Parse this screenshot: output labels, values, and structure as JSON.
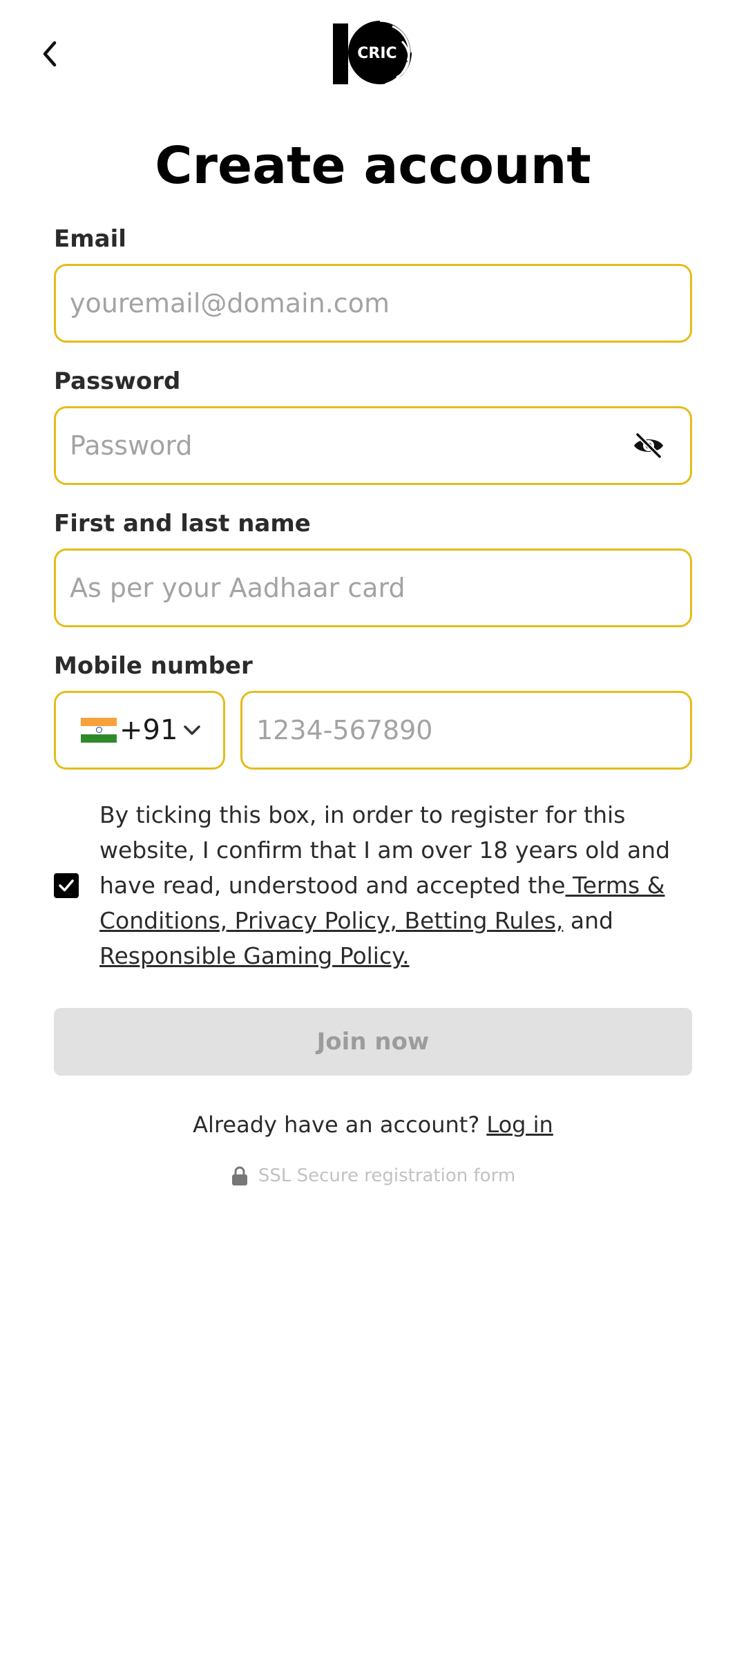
{
  "header": {
    "back_icon": "chevron-left-icon",
    "logo_text": "CRIC"
  },
  "title": "Create account",
  "form": {
    "email": {
      "label": "Email",
      "placeholder": "youremail@domain.com",
      "value": ""
    },
    "password": {
      "label": "Password",
      "placeholder": "Password",
      "value": "",
      "toggle_icon": "eye-off-icon"
    },
    "name": {
      "label": "First and last name",
      "placeholder": "As per your Aadhaar card",
      "value": ""
    },
    "mobile": {
      "label": "Mobile number",
      "country_flag": "india-flag-icon",
      "dial_code": "+91",
      "dropdown_icon": "chevron-down-icon",
      "placeholder": "1234-567890",
      "value": ""
    }
  },
  "consent": {
    "checked": true,
    "text_before": "By ticking this box, in order to register for this website, I confirm that I am over 18 years old and have read, understood and accepted the",
    "link_terms": " Terms & Conditions,",
    "link_privacy": " Privacy Policy,",
    "link_betting": " Betting Rules,",
    "text_and": " and ",
    "link_responsible": "Responsible Gaming Policy."
  },
  "join_button": {
    "label": "Join now",
    "enabled": false
  },
  "login": {
    "prompt": "Already have an account?",
    "link": "Log in"
  },
  "ssl": {
    "icon": "lock-icon",
    "text": "SSL Secure registration form"
  },
  "colors": {
    "accent_border": "#e5bc1a",
    "disabled_button_bg": "#e1e1e1",
    "disabled_button_text": "#9c9c9c",
    "title": "#000000"
  }
}
